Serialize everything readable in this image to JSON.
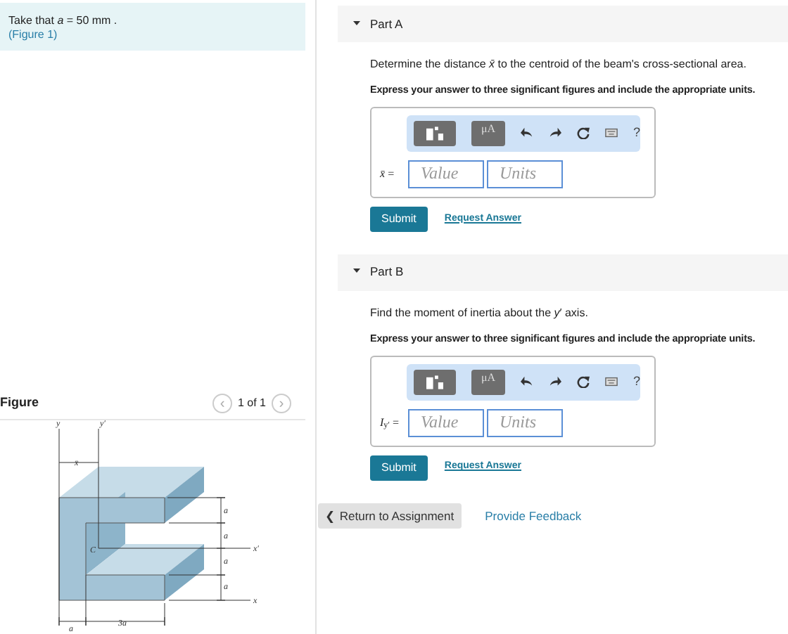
{
  "intro": {
    "text": "Take that *a* = 50 mm .",
    "link": "(Figure 1)"
  },
  "figure": {
    "title": "Figure",
    "pager": "1 of 1",
    "prev": "‹",
    "next": "›",
    "labels": [
      "y",
      "y′",
      "x̄",
      "a",
      "a",
      "a",
      "a",
      "C",
      "x′",
      "x",
      "a",
      "3a"
    ]
  },
  "parts": [
    {
      "title": "Part A",
      "expanded": true,
      "question": "Determine the distance *x̄* to the centroid of the beam's cross-sectional area.",
      "instruction": "Express your answer to three significant figures and include the appropriate units.",
      "toolbar": {
        "units_key": "μA",
        "help": "?"
      },
      "answer_label": "*x̄* =",
      "value_placeholder": "Value",
      "units_placeholder": "Units",
      "submit": "Submit",
      "request": "Request Answer"
    },
    {
      "title": "Part B",
      "expanded": true,
      "question": "Find the moment of inertia about the *y*′ axis.",
      "instruction": "Express your answer to three significant figures and include the appropriate units.",
      "toolbar": {
        "units_key": "μA",
        "help": "?"
      },
      "answer_label": "*I*$_{y′}$ =",
      "value_placeholder": "Value",
      "units_placeholder": "Units",
      "submit": "Submit",
      "request": "Request Answer"
    }
  ],
  "footer": {
    "back": "❮ Return to Assignment",
    "feedback": "Provide Feedback"
  }
}
